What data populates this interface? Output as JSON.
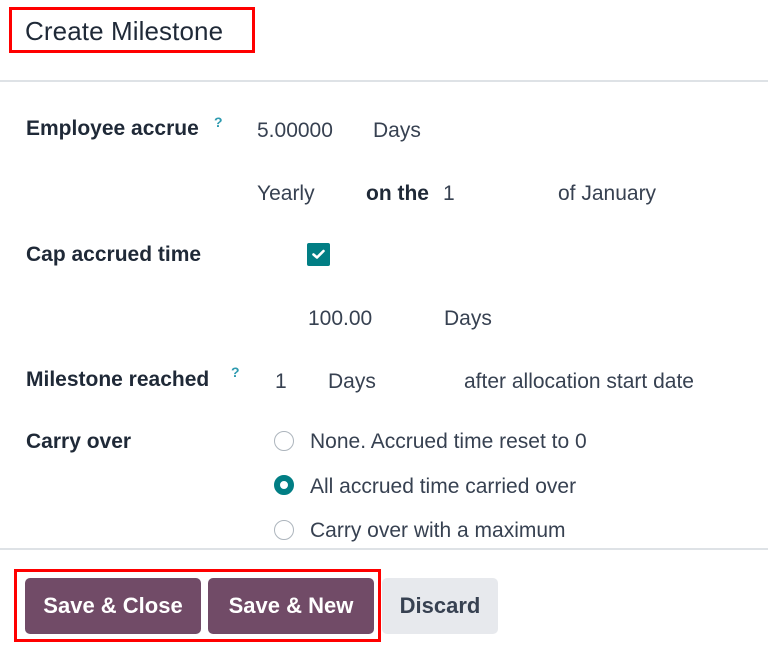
{
  "header": {
    "title": "Create Milestone"
  },
  "form": {
    "employee_accrue": {
      "label": "Employee accrue",
      "help": "?",
      "amount": "5.00000",
      "unit": "Days",
      "frequency": "Yearly",
      "on_the_label": "on the",
      "day": "1",
      "month_text": "of January"
    },
    "cap_accrued_time": {
      "label": "Cap accrued time",
      "checked": true,
      "max_amount": "100.00",
      "max_unit": "Days"
    },
    "milestone_reached": {
      "label": "Milestone reached",
      "help": "?",
      "value": "1",
      "unit": "Days",
      "suffix": "after allocation start date"
    },
    "carry_over": {
      "label": "Carry over",
      "options": [
        {
          "label": "None. Accrued time reset to 0",
          "selected": false
        },
        {
          "label": "All accrued time carried over",
          "selected": true
        },
        {
          "label": "Carry over with a maximum",
          "selected": false
        }
      ]
    }
  },
  "footer": {
    "save_close": "Save & Close",
    "save_new": "Save & New",
    "discard": "Discard"
  },
  "colors": {
    "primary": "#714b67",
    "accent": "#017e84",
    "highlight": "#ff0000"
  }
}
